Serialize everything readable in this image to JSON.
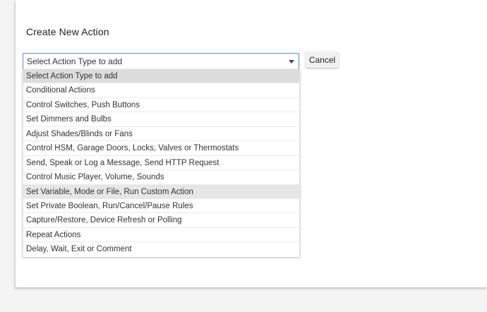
{
  "dialog": {
    "title": "Create New Action"
  },
  "action_type_select": {
    "value": "Select Action Type to add"
  },
  "cancel_label": "Cancel",
  "options": [
    "Select Action Type to add",
    "Conditional Actions",
    "Control Switches, Push Buttons",
    "Set Dimmers and Bulbs",
    "Adjust Shades/Blinds or Fans",
    "Control HSM, Garage Doors, Locks, Valves or Thermostats",
    "Send, Speak or Log a Message, Send HTTP Request",
    "Control Music Player, Volume, Sounds",
    "Set Variable, Mode or File, Run Custom Action",
    "Set Private Boolean, Run/Cancel/Pause Rules",
    "Capture/Restore, Device Refresh or Polling",
    "Repeat Actions",
    "Delay, Wait, Exit or Comment"
  ],
  "selected_option": "Select Action Type to add",
  "hovered_option": "Set Variable, Mode or File, Run Custom Action"
}
